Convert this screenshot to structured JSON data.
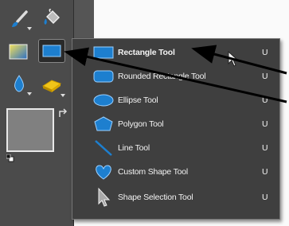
{
  "colors": {
    "toolbox_bg": "#4b4b4b",
    "flyout_bg": "#3f3f3f",
    "shape_blue": "#1d7fcf",
    "menu_text": "#f2f2f2",
    "callout_arrow": "#000000"
  },
  "toolbox": {
    "tools": [
      {
        "icon": "brush-icon"
      },
      {
        "icon": "paint-bucket-icon"
      },
      {
        "icon": "gradient-icon"
      },
      {
        "icon": "rectangle-shape-icon"
      },
      {
        "icon": "blur-drop-icon"
      },
      {
        "icon": "sponge-icon"
      }
    ],
    "foreground_color": "#808080"
  },
  "flyout": {
    "items": [
      {
        "label": "Rectangle Tool",
        "shortcut": "U",
        "icon": "rectangle-icon",
        "selected": true
      },
      {
        "label": "Rounded Rectangle Tool",
        "shortcut": "U",
        "icon": "rounded-rectangle-icon"
      },
      {
        "label": "Ellipse Tool",
        "shortcut": "U",
        "icon": "ellipse-icon"
      },
      {
        "label": "Polygon Tool",
        "shortcut": "U",
        "icon": "polygon-icon"
      },
      {
        "label": "Line Tool",
        "shortcut": "U",
        "icon": "line-icon"
      },
      {
        "label": "Custom Shape Tool",
        "shortcut": "U",
        "icon": "heart-icon"
      },
      {
        "label": "Shape Selection Tool",
        "shortcut": "U",
        "icon": "selection-arrow-icon"
      }
    ]
  }
}
